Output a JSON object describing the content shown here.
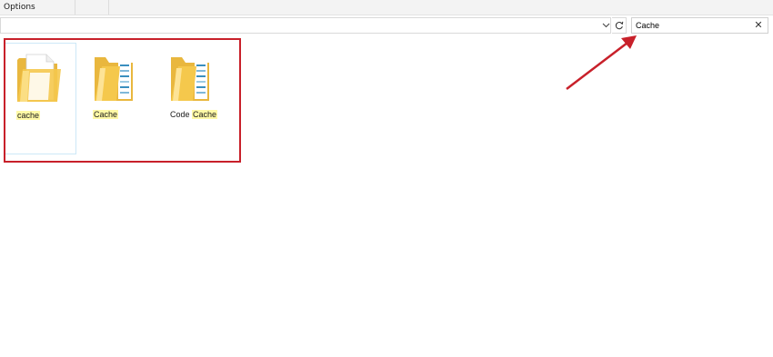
{
  "ribbon": {
    "tabs": [
      {
        "label": "Options"
      },
      {
        "label": ""
      }
    ]
  },
  "address": {
    "value": ""
  },
  "search": {
    "value": "Cache",
    "clear_icon": "close-icon"
  },
  "results": [
    {
      "name_prefix": "",
      "name_match": "cache",
      "type": "file",
      "icon": "document-folder-icon",
      "selected": true
    },
    {
      "name_prefix": "",
      "name_match": "Cache",
      "type": "folder",
      "icon": "folder-icon",
      "selected": false
    },
    {
      "name_prefix": "Code ",
      "name_match": "Cache",
      "type": "folder",
      "icon": "folder-icon",
      "selected": false
    }
  ],
  "colors": {
    "highlight": "#fff9a6",
    "annotation": "#c8202a",
    "folder": "#f5c84c"
  }
}
